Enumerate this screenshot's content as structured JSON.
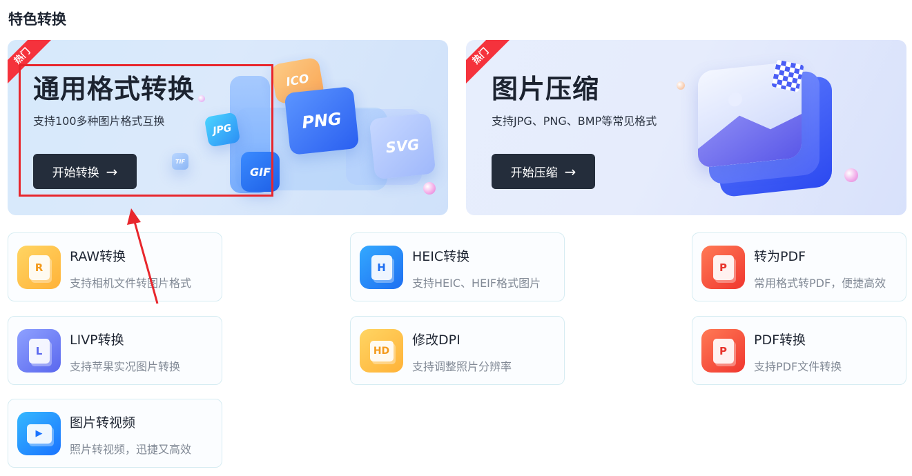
{
  "section": {
    "title": "特色转换"
  },
  "banners": [
    {
      "badge": "热门",
      "title": "通用格式转换",
      "desc": "支持100多种图片格式互换",
      "button": "开始转换",
      "button_icon": "→",
      "format_tiles": [
        "ICO",
        "PNG",
        "JPG",
        "SVG",
        "TIF",
        "GIF"
      ]
    },
    {
      "badge": "热门",
      "title": "图片压缩",
      "desc": "支持JPG、PNG、BMP等常见格式",
      "button": "开始压缩",
      "button_icon": "→"
    }
  ],
  "tools": [
    {
      "glyph": "R",
      "title": "RAW转换",
      "desc": "支持相机文件转图片格式",
      "color": "#ffb238",
      "glyph_color": "#f39a1c"
    },
    {
      "glyph": "H",
      "title": "HEIC转换",
      "desc": "支持HEIC、HEIF格式图片",
      "color": "#1f6ff1",
      "glyph_color": "#1f6ff1"
    },
    {
      "glyph": "P",
      "title": "转为PDF",
      "desc": "常用格式转PDF，便捷高效",
      "color": "#f0362f",
      "glyph_color": "#e8342c"
    },
    {
      "glyph": "L",
      "title": "LIVP转换",
      "desc": "支持苹果实况图片转换",
      "color": "#5a67ee",
      "glyph_color": "#5a67ee"
    },
    {
      "glyph": "HD",
      "title": "修改DPI",
      "desc": "支持调整照片分辨率",
      "color": "#ffb238",
      "glyph_color": "#f39a1c"
    },
    {
      "glyph": "P",
      "title": "PDF转换",
      "desc": "支持PDF文件转换",
      "color": "#f0362f",
      "glyph_color": "#e8342c"
    },
    {
      "glyph": "▶",
      "title": "图片转视频",
      "desc": "照片转视频，迅捷又高效",
      "color": "#1a73ff",
      "glyph_color": "#1a73ff"
    }
  ],
  "annotation": {
    "highlight_color": "#e8262c"
  }
}
